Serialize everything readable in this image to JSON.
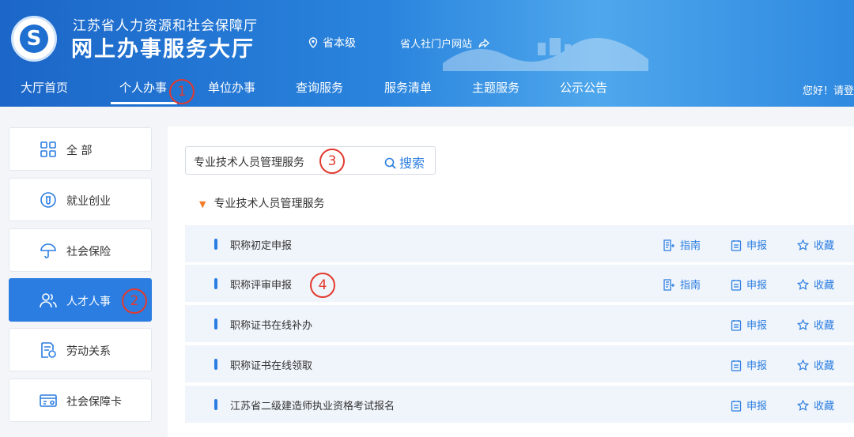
{
  "header": {
    "org": "江苏省人力资源和社会保障厅",
    "title": "网上办事服务大厅",
    "level": "省本级",
    "portal": "省人社门户网站",
    "greeting": "您好！请登"
  },
  "nav": {
    "items": [
      "大厅首页",
      "个人办事",
      "单位办事",
      "查询服务",
      "服务清单",
      "主题服务",
      "公示公告"
    ],
    "active": "个人办事"
  },
  "sidebar": {
    "items": [
      "全 部",
      "就业创业",
      "社会保险",
      "人才人事",
      "劳动关系",
      "社会保障卡"
    ],
    "active": "人才人事"
  },
  "search": {
    "value": "专业技术人员管理服务",
    "button": "搜索"
  },
  "category": {
    "title": "专业技术人员管理服务"
  },
  "services": [
    {
      "name": "职称初定申报",
      "guide": "指南",
      "apply": "申报",
      "fav": "收藏"
    },
    {
      "name": "职称评审申报",
      "guide": "指南",
      "apply": "申报",
      "fav": "收藏"
    },
    {
      "name": "职称证书在线补办",
      "apply": "申报",
      "fav": "收藏"
    },
    {
      "name": "职称证书在线领取",
      "apply": "申报",
      "fav": "收藏"
    },
    {
      "name": "江苏省二级建造师执业资格考试报名",
      "apply": "申报",
      "fav": "收藏"
    }
  ],
  "annotations": [
    "1",
    "2",
    "3",
    "4"
  ],
  "colors": {
    "primary": "#2b7de1",
    "annotation": "#e23a2e",
    "triangle": "#f07c2c"
  }
}
